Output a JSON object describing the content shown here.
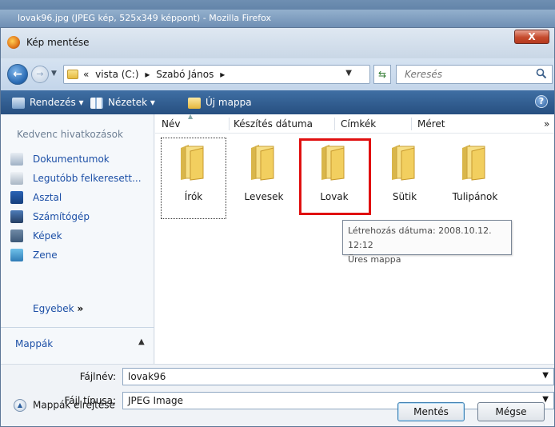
{
  "background_window": {
    "title": "lovak96.jpg (JPEG kép, 525x349 képpont) - Mozilla Firefox"
  },
  "dialog": {
    "title": "Kép mentése",
    "close_label": "X"
  },
  "address": {
    "crumbs": [
      "«",
      "vista (C:)",
      "▸",
      "Szabó János",
      "▸"
    ],
    "search_placeholder": "Keresés"
  },
  "toolbar": {
    "organize": "Rendezés ▾",
    "views": "Nézetek ▾",
    "new_folder": "Új mappa",
    "help": "?"
  },
  "sidebar": {
    "header": "Kedvenc hivatkozások",
    "items": [
      {
        "label": "Dokumentumok",
        "icon": "documents-icon"
      },
      {
        "label": "Legutóbb felkeresett...",
        "icon": "recent-places-icon"
      },
      {
        "label": "Asztal",
        "icon": "desktop-icon"
      },
      {
        "label": "Számítógép",
        "icon": "computer-icon"
      },
      {
        "label": "Képek",
        "icon": "pictures-icon"
      },
      {
        "label": "Zene",
        "icon": "music-icon"
      }
    ],
    "more": "Egyebek",
    "more_suffix": "»",
    "folders_label": "Mappák",
    "folders_toggle": "▲"
  },
  "columns": [
    "Név",
    "Készítés dátuma",
    "Címkék",
    "Méret",
    "»"
  ],
  "folders": [
    {
      "label": "Írók"
    },
    {
      "label": "Levesek"
    },
    {
      "label": "Lovak"
    },
    {
      "label": "Sütik"
    },
    {
      "label": "Tulipánok"
    }
  ],
  "tooltip": {
    "line1": "Létrehozás dátuma: 2008.10.12. 12:12",
    "line2": "Üres mappa"
  },
  "form": {
    "filename_label": "Fájlnév:",
    "filename_value": "lovak96",
    "filetype_label": "Fájl típusa:",
    "filetype_value": "JPEG Image"
  },
  "footer": {
    "hide_folders": "Mappák elrejtése",
    "save": "Mentés",
    "cancel": "Mégse"
  },
  "colors": {
    "toolbar": "#2f5b8f",
    "highlight": "#e01010",
    "link": "#1c4fa6"
  }
}
